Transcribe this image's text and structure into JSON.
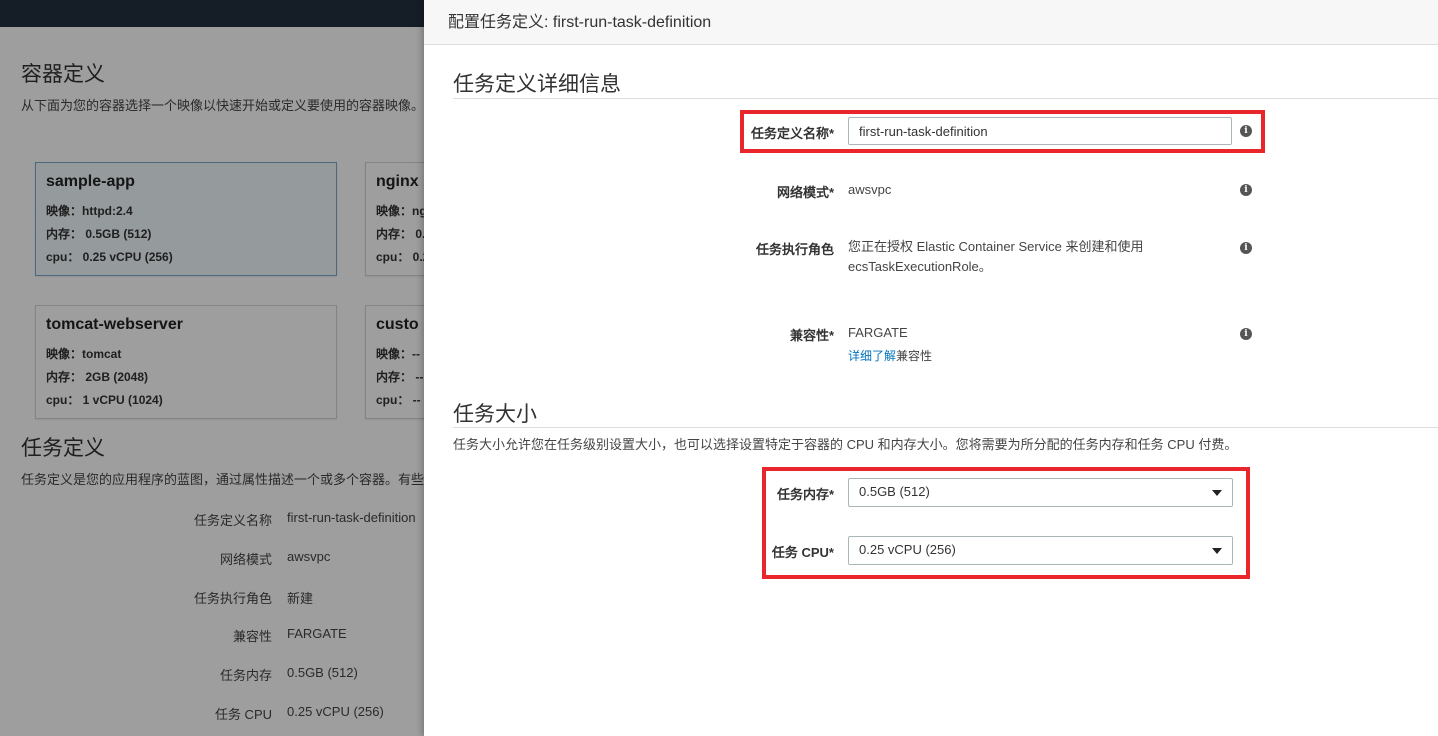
{
  "background_page": {
    "container_section": {
      "title": "容器定义",
      "description": "从下面为您的容器选择一个映像以快速开始或定义要使用的容器映像。",
      "cards": [
        {
          "title": "sample-app",
          "image": "映像：httpd:2.4",
          "memory": "内存：  0.5GB (512)",
          "cpu": "cpu：  0.25 vCPU (256)",
          "selected": true
        },
        {
          "title": "nginx",
          "image": "映像：ng",
          "memory": "内存：  0.",
          "cpu": "cpu：  0.2",
          "selected": false
        },
        {
          "title": "tomcat-webserver",
          "image": "映像：tomcat",
          "memory": "内存：  2GB (2048)",
          "cpu": "cpu：  1 vCPU (1024)",
          "selected": false
        },
        {
          "title": "custo",
          "image": "映像：--",
          "memory": "内存：  --",
          "cpu": "cpu：  --",
          "selected": false
        }
      ]
    },
    "task_section": {
      "title": "任务定义",
      "description": "任务定义是您的应用程序的蓝图，通过属性描述一个或多个容器。有些",
      "summary": [
        {
          "label": "任务定义名称",
          "value": "first-run-task-definition"
        },
        {
          "label": "网络模式",
          "value": "awsvpc"
        },
        {
          "label": "任务执行角色",
          "value": "新建"
        },
        {
          "label": "兼容性",
          "value": "FARGATE"
        },
        {
          "label": "任务内存",
          "value": "0.5GB (512)"
        },
        {
          "label": "任务 CPU",
          "value": "0.25 vCPU (256)"
        }
      ]
    }
  },
  "panel": {
    "header_title": "配置任务定义: first-run-task-definition",
    "details": {
      "title": "任务定义详细信息",
      "name_label": "任务定义名称*",
      "name_value": "first-run-task-definition",
      "network_label": "网络模式*",
      "network_value": "awsvpc",
      "role_label": "任务执行角色",
      "role_value": "您正在授权 Elastic Container Service 来创建和使用 ecsTaskExecutionRole。",
      "compat_label": "兼容性*",
      "compat_value": "FARGATE",
      "compat_link": "详细了解",
      "compat_link_suffix": "兼容性"
    },
    "size": {
      "title": "任务大小",
      "description": "任务大小允许您在任务级别设置大小，也可以选择设置特定于容器的 CPU 和内存大小。您将需要为所分配的任务内存和任务 CPU 付费。",
      "memory_label": "任务内存*",
      "memory_value": "0.5GB (512)",
      "cpu_label": "任务 CPU*",
      "cpu_value": "0.25 vCPU (256)"
    },
    "info_glyph": "i"
  },
  "icons": {
    "info": "info-icon",
    "dropdown": "caret-down-icon"
  },
  "colors": {
    "topbar": "#232f3e",
    "highlight": "#e8262b",
    "link": "#0073bb",
    "card_selected_border": "#79a9cf"
  }
}
